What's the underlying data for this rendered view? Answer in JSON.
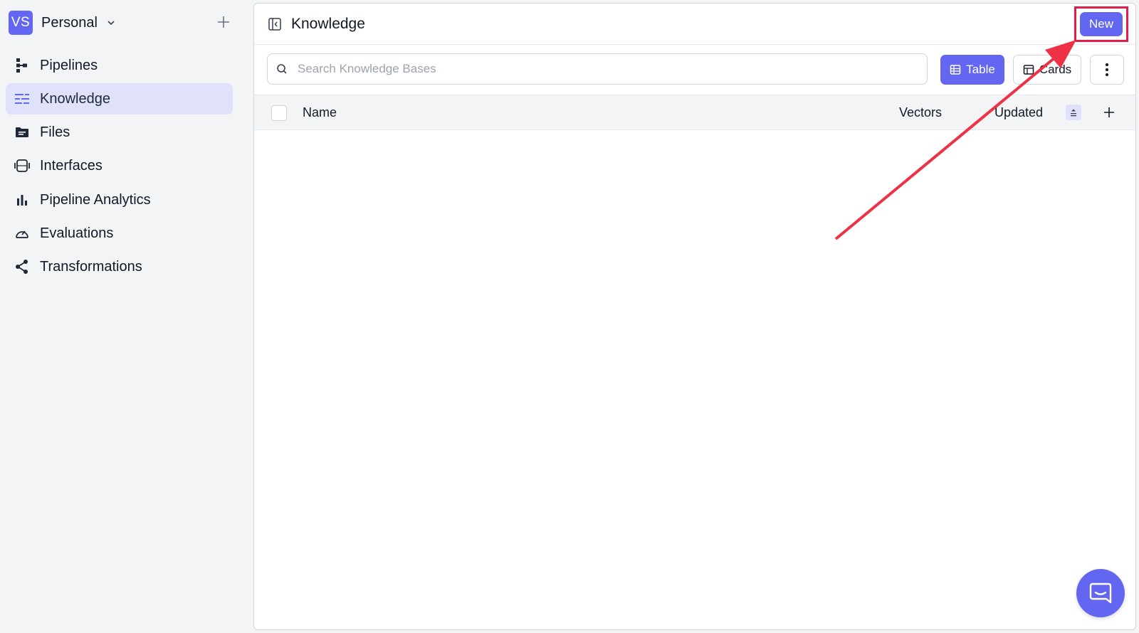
{
  "workspace": {
    "initials": "VS",
    "name": "Personal"
  },
  "sidebar": {
    "items": [
      {
        "label": "Pipelines",
        "icon": "pipeline-icon"
      },
      {
        "label": "Knowledge",
        "icon": "knowledge-icon",
        "active": true
      },
      {
        "label": "Files",
        "icon": "folder-icon"
      },
      {
        "label": "Interfaces",
        "icon": "interfaces-icon"
      },
      {
        "label": "Pipeline Analytics",
        "icon": "bar-chart-icon"
      },
      {
        "label": "Evaluations",
        "icon": "gauge-icon"
      },
      {
        "label": "Transformations",
        "icon": "share-icon"
      }
    ]
  },
  "header": {
    "title": "Knowledge",
    "new_label": "New"
  },
  "toolbar": {
    "search_placeholder": "Search Knowledge Bases",
    "search_value": "",
    "table_label": "Table",
    "cards_label": "Cards"
  },
  "table": {
    "columns": [
      "Name",
      "Vectors",
      "Updated"
    ]
  },
  "colors": {
    "accent": "#6366f1",
    "active_nav_bg": "#e0e1fb",
    "annotation": "#e11d48"
  }
}
